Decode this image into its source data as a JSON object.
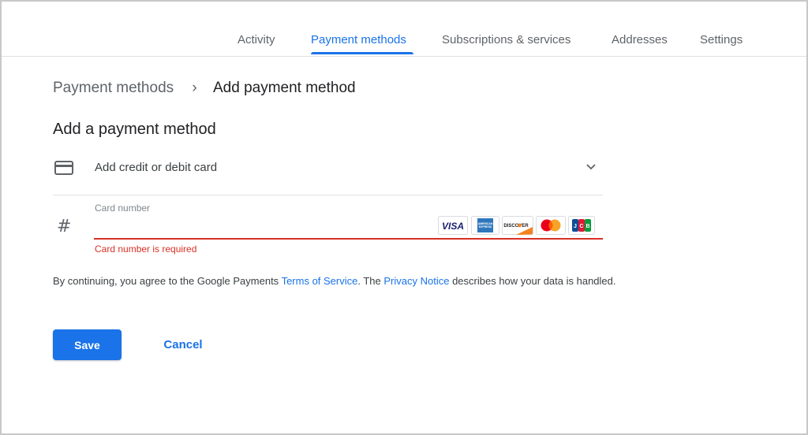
{
  "colors": {
    "accent": "#1a73e8",
    "error": "#d93025",
    "text": "#202124",
    "muted": "#5f6368"
  },
  "nav": {
    "tabs": [
      {
        "label": "Activity",
        "active": false
      },
      {
        "label": "Payment methods",
        "active": true
      },
      {
        "label": "Subscriptions & services",
        "active": false
      },
      {
        "label": "Addresses",
        "active": false
      },
      {
        "label": "Settings",
        "active": false
      }
    ]
  },
  "breadcrumb": {
    "parent": "Payment methods",
    "separator": "›",
    "current": "Add payment method"
  },
  "heading": "Add a payment method",
  "card_option": {
    "icon": "credit-card-icon",
    "label": "Add credit or debit card",
    "chevron": "chevron-down-icon"
  },
  "card_field": {
    "icon": "hash-icon",
    "hash_glyph": "#",
    "label": "Card number",
    "value": "",
    "error": "Card number is required",
    "brands": [
      "VISA",
      "AMERICAN EXPRESS",
      "DISCOVER",
      "Mastercard",
      "JCB"
    ]
  },
  "terms": {
    "prefix": "By continuing, you agree to the Google Payments ",
    "tos_link": "Terms of Service",
    "middle": ". The ",
    "privacy_link": "Privacy Notice",
    "suffix": " describes how your data is handled."
  },
  "actions": {
    "save_label": "Save",
    "cancel_label": "Cancel"
  }
}
